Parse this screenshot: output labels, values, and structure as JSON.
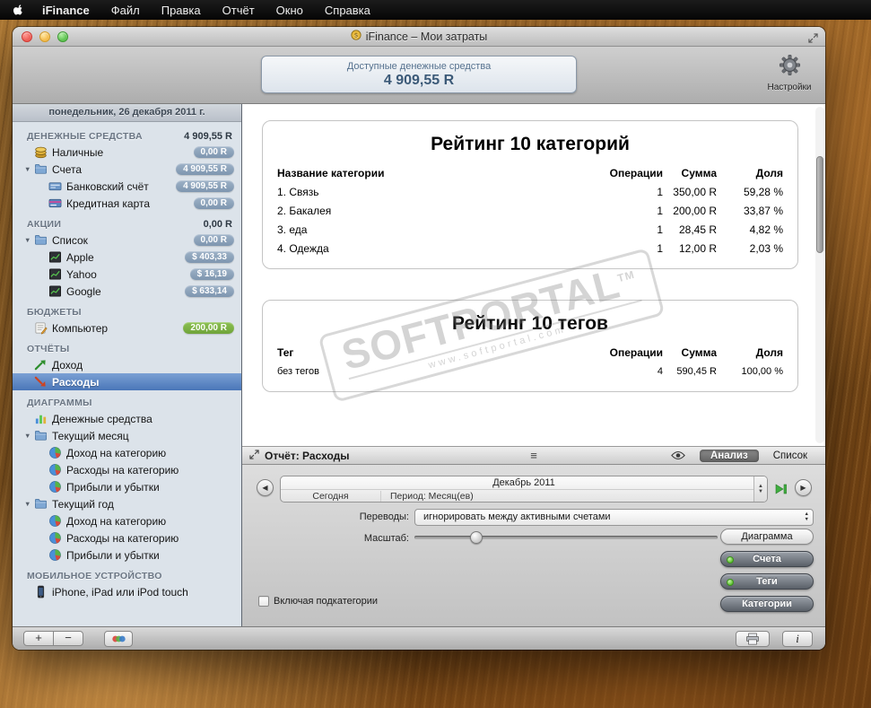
{
  "menubar": {
    "items": [
      "iFinance",
      "Файл",
      "Правка",
      "Отчёт",
      "Окно",
      "Справка"
    ]
  },
  "window": {
    "title": "iFinance – Мои затраты"
  },
  "toolbar": {
    "funds_label": "Доступные денежные средства",
    "funds_value": "4 909,55 R",
    "settings_label": "Настройки"
  },
  "sidebar": {
    "date_header": "понедельник, 26 декабря 2011 г.",
    "sections": [
      {
        "title": "ДЕНЕЖНЫЕ СРЕДСТВА",
        "value": "4 909,55 R",
        "items": [
          {
            "label": "Наличные",
            "badge": "0,00 R",
            "icon": "coins"
          },
          {
            "label": "Счета",
            "badge": "4 909,55 R",
            "icon": "folder",
            "disclosure": true
          },
          {
            "label": "Банковский счёт",
            "badge": "4 909,55 R",
            "icon": "bank",
            "indent": 1
          },
          {
            "label": "Кредитная карта",
            "badge": "0,00 R",
            "icon": "card",
            "indent": 1
          }
        ]
      },
      {
        "title": "АКЦИИ",
        "value": "0,00 R",
        "items": [
          {
            "label": "Список",
            "badge": "0,00 R",
            "icon": "folder",
            "disclosure": true
          },
          {
            "label": "Apple",
            "badge": "$ 403,33",
            "icon": "stock",
            "indent": 1
          },
          {
            "label": "Yahoo",
            "badge": "$ 16,19",
            "icon": "stock",
            "indent": 1
          },
          {
            "label": "Google",
            "badge": "$ 633,14",
            "icon": "stock",
            "indent": 1
          }
        ]
      },
      {
        "title": "БЮДЖЕТЫ",
        "items": [
          {
            "label": "Компьютер",
            "badge": "200,00 R",
            "badge_color": "green",
            "icon": "budget"
          }
        ]
      },
      {
        "title": "ОТЧЁТЫ",
        "items": [
          {
            "label": "Доход",
            "icon": "income"
          },
          {
            "label": "Расходы",
            "icon": "expense",
            "selected": true
          }
        ]
      },
      {
        "title": "ДИАГРАММЫ",
        "items": [
          {
            "label": "Денежные средства",
            "icon": "chart"
          },
          {
            "label": "Текущий месяц",
            "icon": "folder",
            "disclosure": true
          },
          {
            "label": "Доход на категорию",
            "icon": "pie",
            "indent": 1
          },
          {
            "label": "Расходы на категорию",
            "icon": "pie",
            "indent": 1
          },
          {
            "label": "Прибыли и убытки",
            "icon": "pie",
            "indent": 1
          },
          {
            "label": "Текущий год",
            "icon": "folder",
            "disclosure": true
          },
          {
            "label": "Доход на категорию",
            "icon": "pie",
            "indent": 1
          },
          {
            "label": "Расходы на категорию",
            "icon": "pie",
            "indent": 1
          },
          {
            "label": "Прибыли и убытки",
            "icon": "pie",
            "indent": 1
          }
        ]
      },
      {
        "title": "МОБИЛЬНОЕ УСТРОЙСТВО",
        "items": [
          {
            "label": "iPhone, iPad или iPod touch",
            "icon": "device"
          }
        ]
      }
    ]
  },
  "report": {
    "categories": {
      "title": "Рейтинг 10 категорий",
      "headers": [
        "Название категории",
        "Операции",
        "Сумма",
        "Доля"
      ],
      "rows": [
        [
          "1. Связь",
          "1",
          "350,00 R",
          "59,28 %"
        ],
        [
          "2. Бакалея",
          "1",
          "200,00 R",
          "33,87 %"
        ],
        [
          "3. еда",
          "1",
          "28,45 R",
          "4,82 %"
        ],
        [
          "4. Одежда",
          "1",
          "12,00 R",
          "2,03 %"
        ]
      ]
    },
    "tags": {
      "title": "Рейтинг 10 тегов",
      "headers": [
        "Тег",
        "Операции",
        "Сумма",
        "Доля"
      ],
      "rows": [
        [
          "без тегов",
          "4",
          "590,45 R",
          "100,00 %"
        ]
      ]
    }
  },
  "watermark": {
    "text": "SOFTPORTAL",
    "tm": "TM",
    "url": "www.softportal.com"
  },
  "panel": {
    "title": "Отчёт: Расходы",
    "tabs": [
      {
        "label": "Анализ",
        "active": true
      },
      {
        "label": "Список",
        "active": false
      }
    ],
    "month": "Декабрь 2011",
    "today": "Сегодня",
    "period": "Период: Месяц(ев)",
    "transfers_label": "Переводы:",
    "transfers_value": "игнорировать между активными счетами",
    "scale_label": "Масштаб:",
    "scale_percent": 20,
    "chart_button": "Диаграмма",
    "pill_buttons": [
      {
        "label": "Счета",
        "dot": true
      },
      {
        "label": "Теги",
        "dot": true
      },
      {
        "label": "Категории",
        "dot": false
      }
    ],
    "checkbox_label": "Включая подкатегории",
    "checkbox_checked": false
  },
  "footer": {
    "add": "+",
    "remove": "−"
  },
  "colors": {
    "selection_blue": "#4a76b8",
    "badge_gray": "#8aa0b8",
    "badge_green": "#7cb342",
    "menubar_black": "#0b0b0b"
  }
}
